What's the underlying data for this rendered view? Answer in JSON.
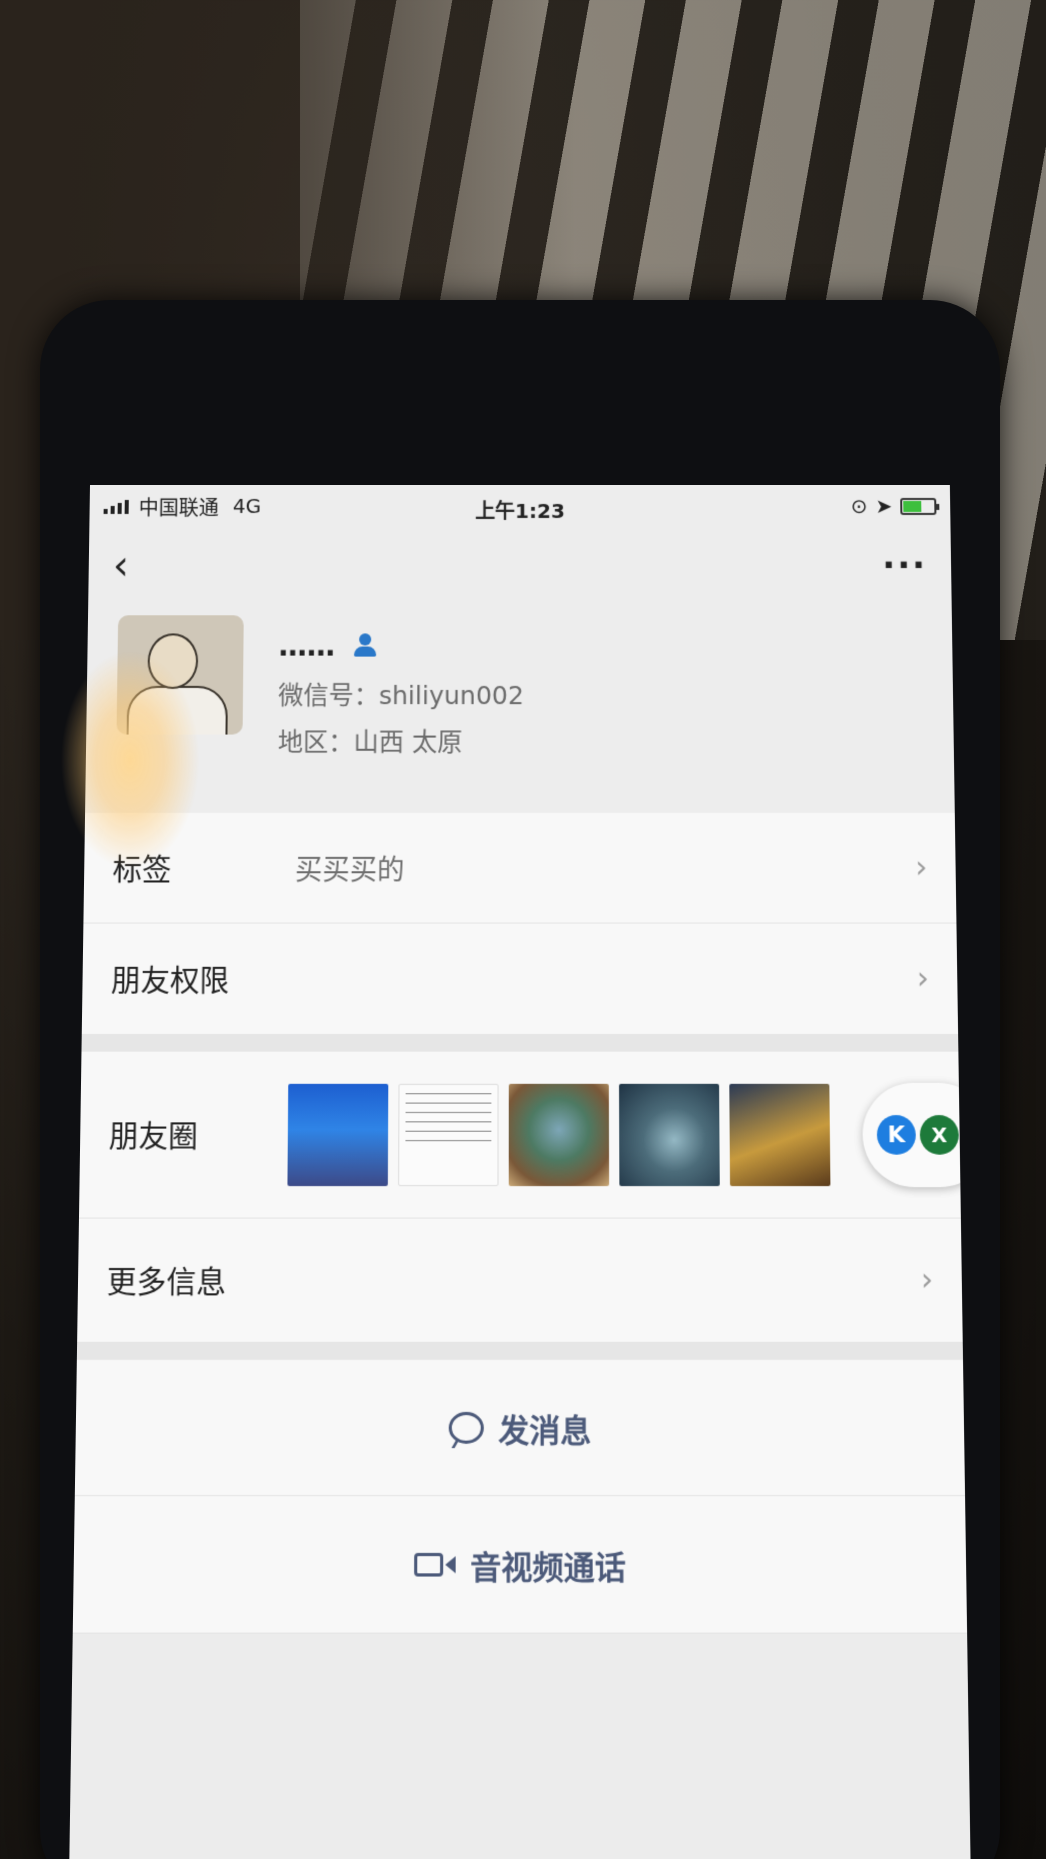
{
  "status_bar": {
    "carrier": "中国联通",
    "network": "4G",
    "time": "上午1:23",
    "battery_level": 0.6
  },
  "nav": {
    "back_icon": "chevron-left-icon",
    "more_icon": "more-dots-icon"
  },
  "profile": {
    "nickname": "……",
    "wechat_id": "微信号：shiliyun002",
    "region": "地区：山西 太原"
  },
  "rows": {
    "tags_label": "标签",
    "tags_value": "买买买的",
    "permissions_label": "朋友权限",
    "moments_label": "朋友圈",
    "more_info_label": "更多信息"
  },
  "actions": {
    "message_label": "发消息",
    "call_label": "音视频通话"
  },
  "floating_bubble": {
    "k_label": "K",
    "x_label": "X"
  },
  "colors": {
    "accent_text": "#4c5a7a",
    "verified_icon": "#2a78c9"
  }
}
